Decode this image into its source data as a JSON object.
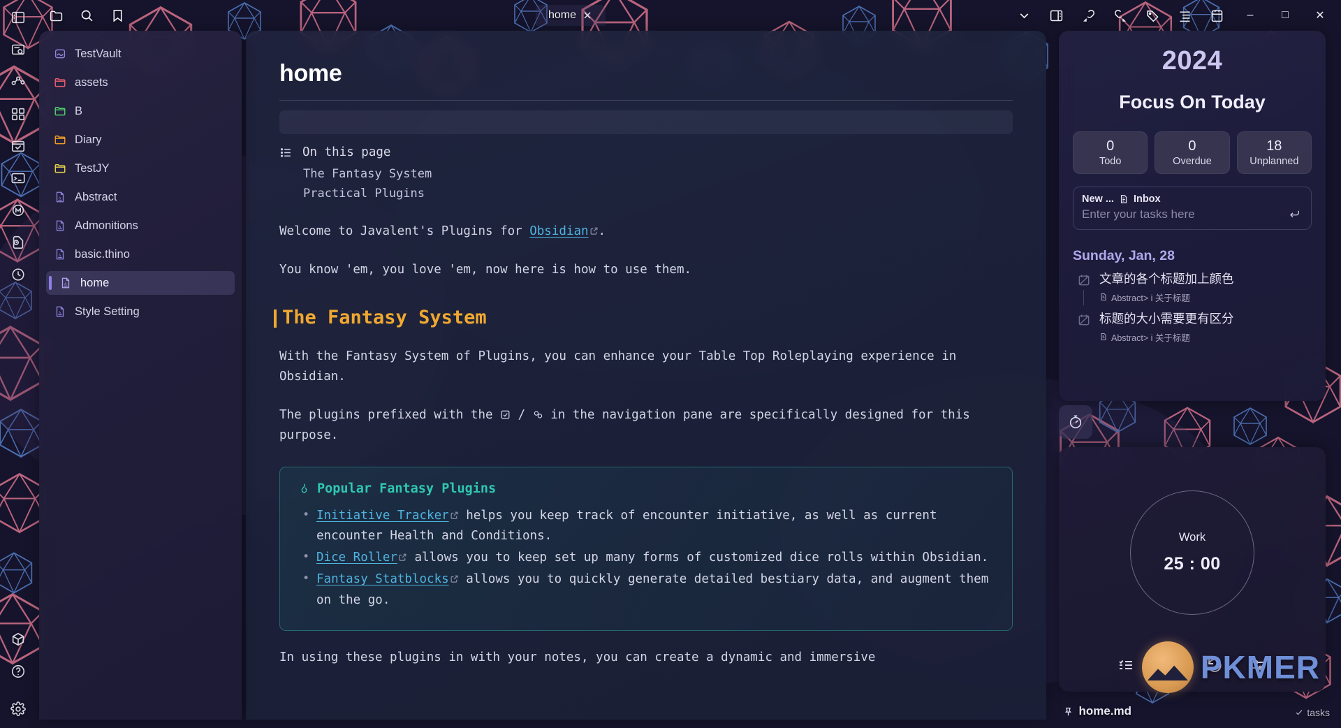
{
  "ribbon": {
    "icons": [
      {
        "name": "toggle-left-sidebar-icon"
      },
      {
        "name": "quick-explorer-icon"
      },
      {
        "name": "graph-view-icon"
      },
      {
        "name": "canvas-icon"
      },
      {
        "name": "daily-note-icon"
      },
      {
        "name": "terminal-icon"
      },
      {
        "name": "mermaid-icon"
      },
      {
        "name": "file-history-icon"
      },
      {
        "name": "clock-icon"
      }
    ],
    "bottom_icons": [
      {
        "name": "cube-icon"
      },
      {
        "name": "help-icon"
      },
      {
        "name": "settings-gear-icon"
      }
    ]
  },
  "titlebar": {
    "left_icons": [
      {
        "name": "folder-icon"
      },
      {
        "name": "search-icon"
      },
      {
        "name": "bookmark-icon"
      }
    ],
    "tab_label": "home",
    "right_icons": [
      {
        "name": "chevron-down-icon"
      },
      {
        "name": "toggle-right-sidebar-icon"
      },
      {
        "name": "link-back-icon"
      },
      {
        "name": "link-forward-icon"
      },
      {
        "name": "tag-icon"
      },
      {
        "name": "outline-icon"
      },
      {
        "name": "calendar-icon"
      }
    ],
    "window_controls": {
      "minimize": "–",
      "maximize": "□",
      "close": "✕"
    }
  },
  "explorer": {
    "items": [
      {
        "label": "TestVault",
        "type": "vault",
        "color": "#8f86e0",
        "selected": false
      },
      {
        "label": "assets",
        "type": "folder",
        "color": "#ef5d6f",
        "selected": false
      },
      {
        "label": "B",
        "type": "folder",
        "color": "#4ed16a",
        "selected": false
      },
      {
        "label": "Diary",
        "type": "folder",
        "color": "#ef9b24",
        "selected": false
      },
      {
        "label": "TestJY",
        "type": "folder",
        "color": "#e8d54a",
        "selected": false
      },
      {
        "label": "Abstract",
        "type": "file",
        "color": "#8f86e0",
        "selected": false
      },
      {
        "label": "Admonitions",
        "type": "file",
        "color": "#8f86e0",
        "selected": false
      },
      {
        "label": "basic.thino",
        "type": "file",
        "color": "#8f86e0",
        "selected": false
      },
      {
        "label": "home",
        "type": "file",
        "color": "#b0a6f0",
        "selected": true
      },
      {
        "label": "Style Setting",
        "type": "file",
        "color": "#8f86e0",
        "selected": false
      }
    ]
  },
  "note": {
    "title": "home",
    "on_this_page": {
      "heading": "On this page",
      "items": [
        "The Fantasy System",
        "Practical Plugins"
      ]
    },
    "para1_before": "Welcome to Javalent's Plugins for ",
    "para1_link": "Obsidian",
    "para1_after": ".",
    "para2": "You know 'em, you love 'em, now here is how to use them.",
    "h2": "The Fantasy System",
    "para3": "With the Fantasy System of Plugins, you can enhance your Table Top Roleplaying experience in Obsidian.",
    "para4_a": "The plugins prefixed with the ",
    "para4_b": " / ",
    "para4_c": " in the navigation pane are specifically designed for this purpose.",
    "callout": {
      "title": "Popular Fantasy Plugins",
      "items": [
        {
          "link": "Initiative Tracker",
          "rest": " helps you keep track of encounter initiative, as well as current encounter Health and Conditions."
        },
        {
          "link": "Dice Roller",
          "rest": " allows you to keep set up many forms of customized dice rolls within Obsidian."
        },
        {
          "link": "Fantasy Statblocks",
          "rest": " allows you to quickly generate detailed bestiary data, and augment them on the go."
        }
      ]
    },
    "para5": "In using these plugins in with your notes, you can create a dynamic and immersive"
  },
  "focus_panel": {
    "year": "2024",
    "subtitle": "Focus On Today",
    "stats": [
      {
        "number": "0",
        "label": "Todo"
      },
      {
        "number": "0",
        "label": "Overdue"
      },
      {
        "number": "18",
        "label": "Unplanned"
      }
    ],
    "input_prefix": "New ...",
    "input_target": "Inbox",
    "input_placeholder": "Enter your tasks here",
    "day_label": "Sunday, Jan, 28",
    "tasks": [
      {
        "text": "文章的各个标题加上颜色",
        "source": "Abstract> i 关于标题"
      },
      {
        "text": "标题的大小需要更有区分",
        "source": "Abstract> i 关于标题"
      }
    ]
  },
  "pomodoro": {
    "mode": "Work",
    "time": "25 : 00",
    "controls": [
      {
        "name": "task-list-icon"
      },
      {
        "name": "play-icon"
      },
      {
        "name": "reset-icon"
      },
      {
        "name": "settings-sliders-icon"
      }
    ]
  },
  "statusbar": {
    "file": "home.md",
    "right_text": "tasks"
  },
  "watermark": {
    "text": "PKMER"
  },
  "colors": {
    "accent_purple": "#8f7ee8",
    "heading_orange": "#f0a830",
    "callout_teal": "#2fc7b3",
    "link_blue": "#4fb3e0",
    "focus_year": "#ccc7f0"
  }
}
